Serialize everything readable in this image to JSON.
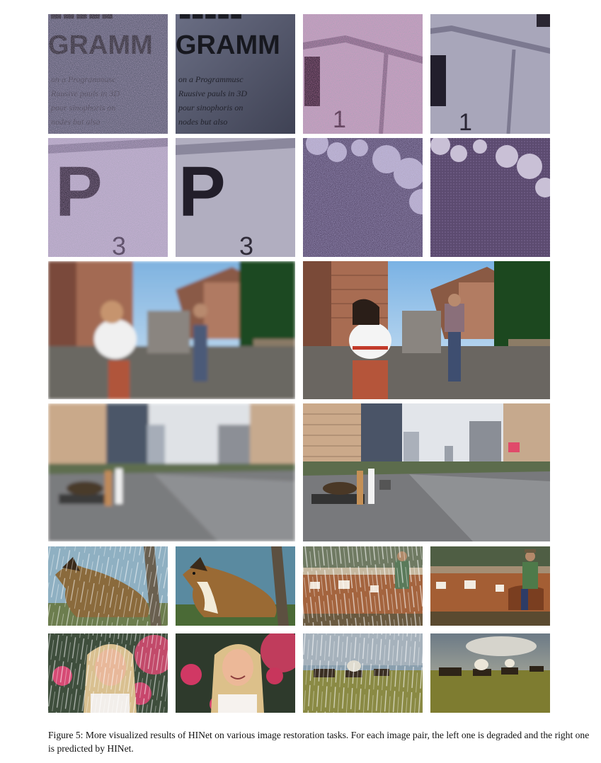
{
  "figure": {
    "caption": "Figure 5: More visualized results of HINet on various image restoration tasks. For each image pair, the left one is degraded and the right one is predicted by HINet."
  },
  "panel_text": {
    "gramm": "GRAMM",
    "lines": [
      "on a Programmusc",
      "Ruusive pauls in 3D",
      "pour sinophoris on",
      "nodes but also"
    ],
    "digit_one": "1",
    "letter_p": "P",
    "digit_three": "3"
  }
}
